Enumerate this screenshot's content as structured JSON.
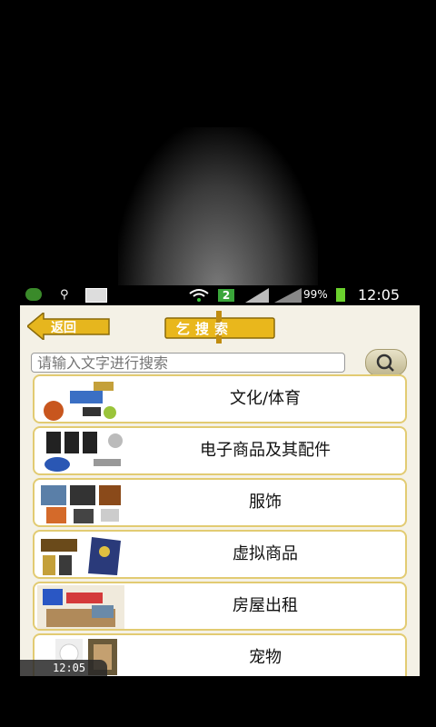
{
  "status_bar": {
    "battery": "99%",
    "time": "12:05",
    "notification_count": "2",
    "icons": [
      "app-badge-icon",
      "usb-icon",
      "download-icon",
      "wifi-icon",
      "signal-icon",
      "battery-icon"
    ]
  },
  "app_bar": {
    "back_label": "返回",
    "logo_label": "乞搜索"
  },
  "search": {
    "placeholder": "请输入文字进行搜索",
    "button_icon": "search-icon"
  },
  "categories": [
    {
      "label": "文化/体育"
    },
    {
      "label": "电子商品及其配件"
    },
    {
      "label": "服饰"
    },
    {
      "label": "虚拟商品"
    },
    {
      "label": "房屋出租"
    },
    {
      "label": "宠物"
    }
  ],
  "overlay_clock": "12:05",
  "colors": {
    "accent": "#e2cb72",
    "background": "#f4f1e6",
    "status_bar": "#000000"
  }
}
